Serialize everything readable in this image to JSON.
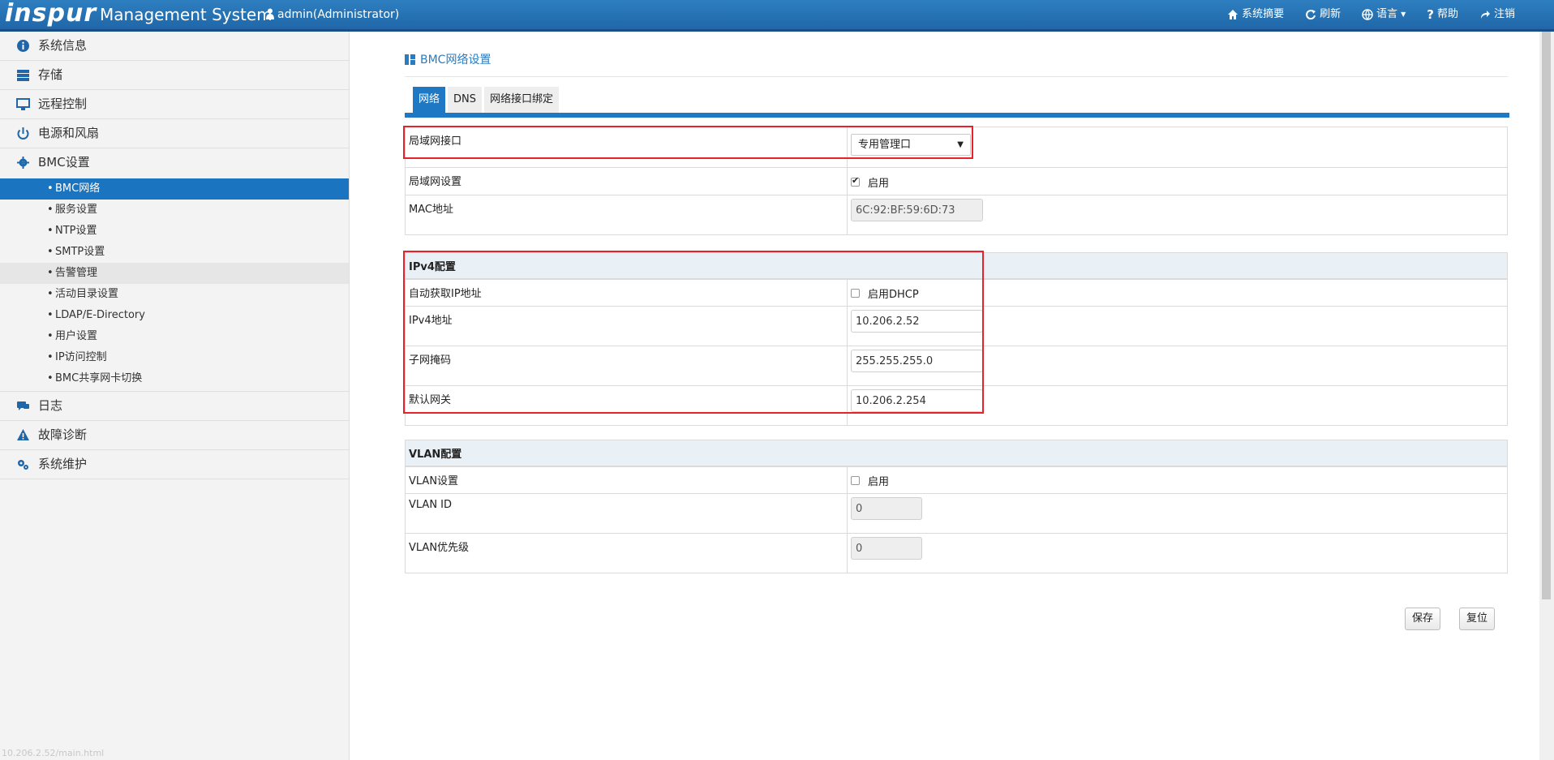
{
  "header": {
    "logo": "inspur",
    "app_name": "Management System",
    "user": "admin(Administrator)",
    "nav": [
      {
        "label": "系统摘要",
        "icon": "home-icon"
      },
      {
        "label": "刷新",
        "icon": "refresh-icon"
      },
      {
        "label": "语言",
        "icon": "globe-icon"
      },
      {
        "label": "帮助",
        "icon": "help-icon"
      },
      {
        "label": "注销",
        "icon": "logout-icon"
      }
    ]
  },
  "sidebar": {
    "items": [
      {
        "label": "系统信息",
        "icon": "info-icon"
      },
      {
        "label": "存储",
        "icon": "storage-icon"
      },
      {
        "label": "远程控制",
        "icon": "monitor-icon"
      },
      {
        "label": "电源和风扇",
        "icon": "power-icon"
      },
      {
        "label": "BMC设置",
        "icon": "gear-icon"
      },
      {
        "label": "日志",
        "icon": "chat-icon"
      },
      {
        "label": "故障诊断",
        "icon": "warning-icon"
      },
      {
        "label": "系统维护",
        "icon": "gears-icon"
      }
    ],
    "bmc_sub": [
      "BMC网络",
      "服务设置",
      "NTP设置",
      "SMTP设置",
      "告警管理",
      "活动目录设置",
      "LDAP/E-Directory",
      "用户设置",
      "IP访问控制",
      "BMC共享网卡切换"
    ],
    "status_url": "10.206.2.52/main.html"
  },
  "main": {
    "title": "BMC网络设置",
    "tabs": [
      "网络",
      "DNS",
      "网络接口绑定"
    ],
    "lan": {
      "interface_label": "局域网接口",
      "interface_value": "专用管理口",
      "setting_label": "局域网设置",
      "setting_check": "启用",
      "mac_label": "MAC地址",
      "mac_value": "6C:92:BF:59:6D:73"
    },
    "ipv4": {
      "heading": "IPv4配置",
      "dhcp_label": "自动获取IP地址",
      "dhcp_check": "启用DHCP",
      "addr_label": "IPv4地址",
      "addr_value": "10.206.2.52",
      "mask_label": "子网掩码",
      "mask_value": "255.255.255.0",
      "gw_label": "默认网关",
      "gw_value": "10.206.2.254"
    },
    "vlan": {
      "heading": "VLAN配置",
      "setting_label": "VLAN设置",
      "setting_check": "启用",
      "id_label": "VLAN ID",
      "id_value": "0",
      "prio_label": "VLAN优先级",
      "prio_value": "0"
    },
    "buttons": {
      "save": "保存",
      "reset": "复位"
    }
  },
  "colors": {
    "header": "#1f67a8",
    "accent": "#1f78c4",
    "highlight": "#e8222b"
  }
}
